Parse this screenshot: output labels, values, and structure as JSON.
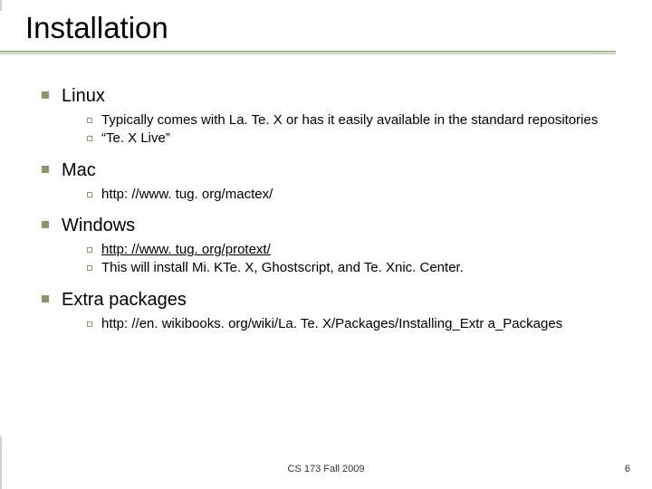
{
  "title": "Installation",
  "sections": [
    {
      "heading": "Linux",
      "items": [
        {
          "text": "Typically comes with La. Te. X or has it easily available in the standard repositories",
          "link": false
        },
        {
          "text": "“Te. X Live”",
          "link": false
        }
      ]
    },
    {
      "heading": "Mac",
      "items": [
        {
          "text": "http: //www. tug. org/mactex/",
          "link": false
        }
      ]
    },
    {
      "heading": "Windows",
      "items": [
        {
          "text": "http: //www. tug. org/protext/",
          "link": true
        },
        {
          "text": "This will install Mi. KTe. X, Ghostscript, and Te. Xnic. Center.",
          "link": false
        }
      ]
    },
    {
      "heading": "Extra packages",
      "items": [
        {
          "text": "http: //en. wikibooks. org/wiki/La. Te. X/Packages/Installing_Extr a_Packages",
          "link": false
        }
      ]
    }
  ],
  "footer": {
    "center": "CS 173 Fall 2009",
    "right": "6"
  }
}
